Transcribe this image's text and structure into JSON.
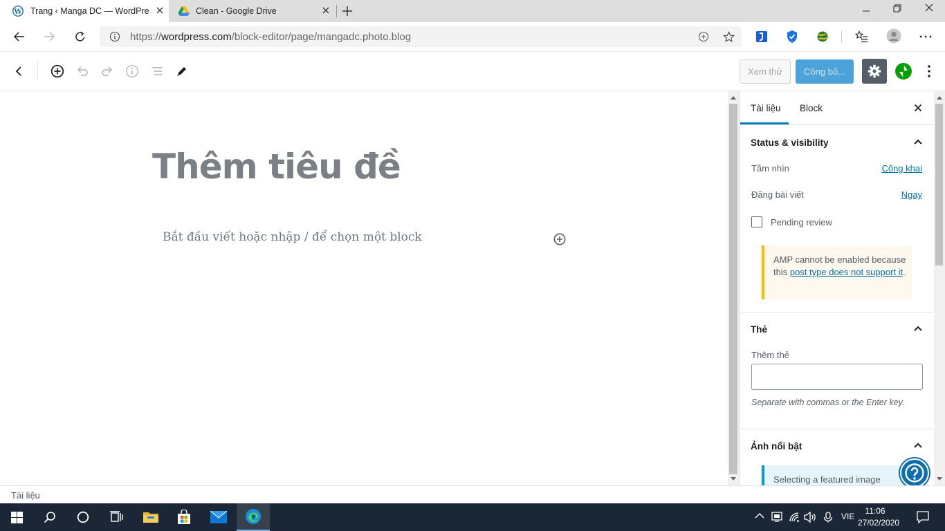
{
  "browser": {
    "tabs": [
      {
        "title": "Trang ‹ Manga DC — WordPress",
        "icon": "wordpress-icon",
        "active": true
      },
      {
        "title": "Clean - Google Drive",
        "icon": "google-drive-icon",
        "active": false
      }
    ],
    "url_prefix": "https://",
    "url_domain": "wordpress.com",
    "url_path": "/block-editor/page/mangadc.photo.blog"
  },
  "toolbar": {
    "preview_label": "Xem thử",
    "publish_label": "Công bố...",
    "accent_color": "#007cba",
    "jetpack_color": "#069e08"
  },
  "editor": {
    "title_placeholder": "Thêm tiêu đề",
    "block_placeholder": "Bắt đầu viết hoặc nhập / để chọn một block"
  },
  "sidebar": {
    "tab_document": "Tài liệu",
    "tab_block": "Block",
    "status_panel": {
      "title": "Status & visibility",
      "visibility_label": "Tầm nhìn",
      "visibility_value": "Công khai",
      "publish_label": "Đăng bài viết",
      "publish_value": "Ngay",
      "pending_review_label": "Pending review",
      "pending_review_checked": false,
      "amp_text_1": "AMP cannot be enabled because this ",
      "amp_link": "post type does not support it",
      "amp_text_2": "."
    },
    "tags_panel": {
      "title": "Thẻ",
      "add_label": "Thêm thẻ",
      "input_value": "",
      "help": "Separate with commas or the Enter key."
    },
    "featured_panel": {
      "title": "Ảnh nổi bật",
      "notice": "Selecting a featured image"
    }
  },
  "footer": {
    "breadcrumb": "Tài liệu"
  },
  "taskbar": {
    "language": "VIE",
    "time": "11:06",
    "date": "27/02/2020"
  }
}
